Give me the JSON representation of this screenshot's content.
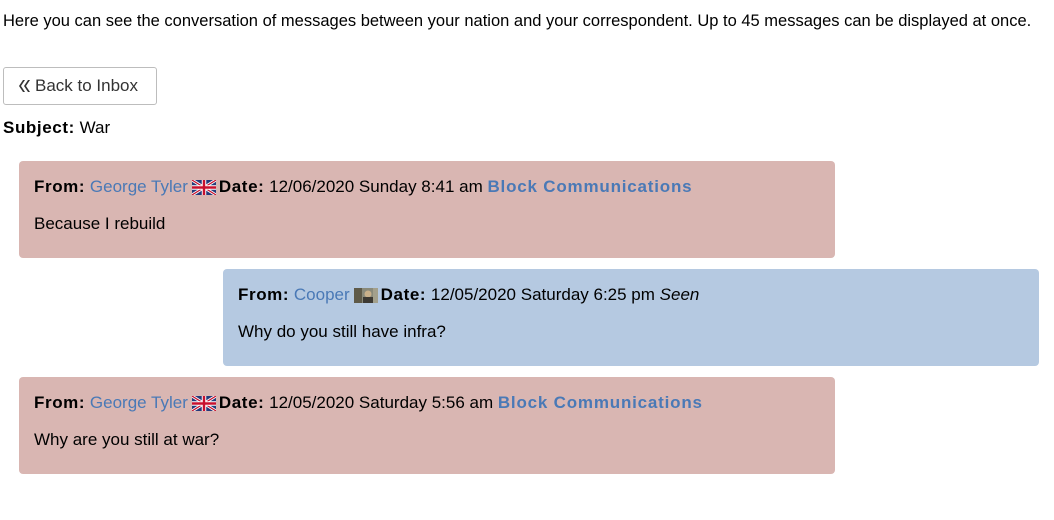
{
  "intro": "Here you can see the conversation of messages between your nation and your correspondent. Up to 45 messages can be displayed at once.",
  "back_button": {
    "label": "Back to Inbox",
    "icon": "double-chevron-left-icon"
  },
  "subject": {
    "label": "Subject:",
    "value": "War"
  },
  "labels": {
    "from": "From:",
    "date": "Date:"
  },
  "messages": [
    {
      "direction": "outgoing",
      "sender": "George Tyler",
      "flag": "uk-flag-icon",
      "date": "12/06/2020 Sunday 8:41 am",
      "action": "Block Communications",
      "body": "Because I rebuild"
    },
    {
      "direction": "incoming",
      "sender": "Cooper",
      "flag": "nation-flag-icon",
      "date": "12/05/2020 Saturday 6:25 pm",
      "status": "Seen",
      "body": "Why do you still have infra?"
    },
    {
      "direction": "outgoing",
      "sender": "George Tyler",
      "flag": "uk-flag-icon",
      "date": "12/05/2020 Saturday 5:56 am",
      "action": "Block Communications",
      "body": "Why are you still at war?"
    }
  ],
  "colors": {
    "outgoing_bg": "#d9b6b2",
    "incoming_bg": "#b5c9e1",
    "link": "#4a79b6"
  }
}
